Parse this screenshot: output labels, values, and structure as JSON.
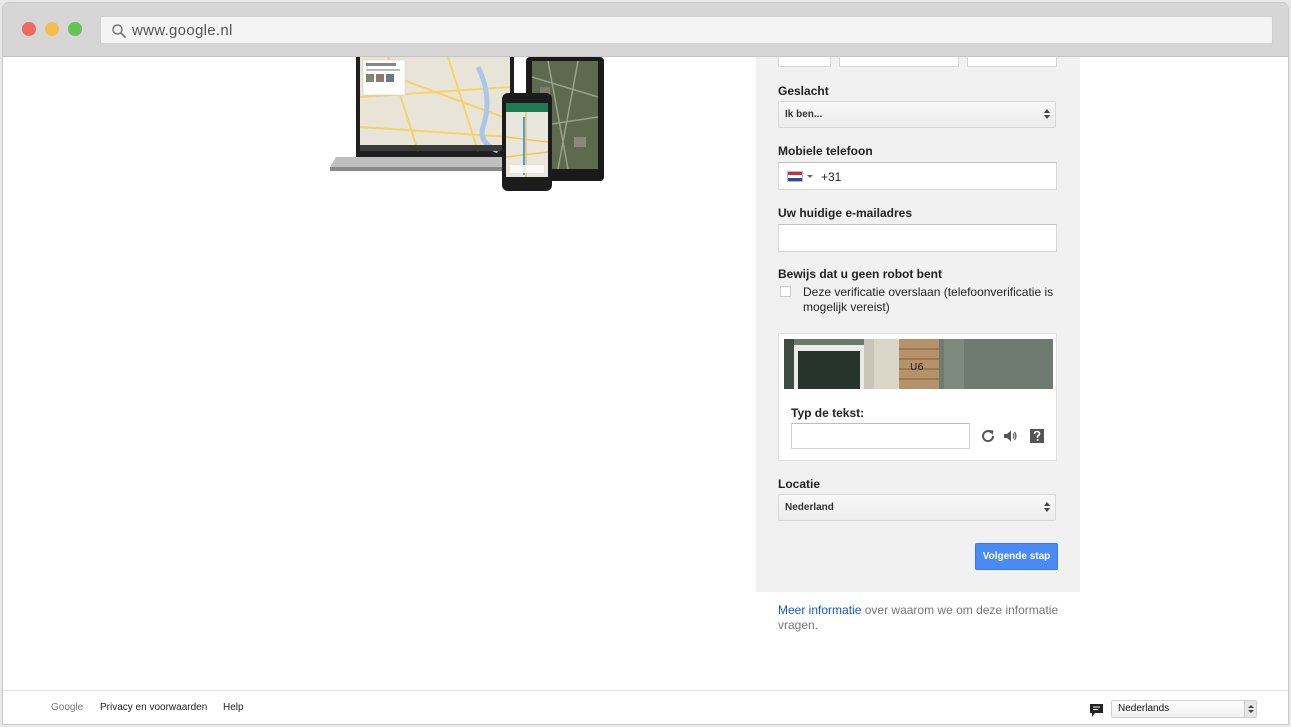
{
  "browser": {
    "url": "www.google.nl"
  },
  "form": {
    "gender": {
      "label": "Geslacht",
      "value": "Ik ben..."
    },
    "phone": {
      "label": "Mobiele telefoon",
      "prefix": "+31"
    },
    "email": {
      "label": "Uw huidige e-mailadres"
    },
    "robot": {
      "label": "Bewijs dat u geen robot bent",
      "skip_text": "Deze verificatie overslaan (telefoonverificatie is mogelijk vereist)"
    },
    "captcha": {
      "label": "Typ de tekst:",
      "image_text": "U6"
    },
    "location": {
      "label": "Locatie",
      "value": "Nederland"
    },
    "next_button": "Volgende stap"
  },
  "info": {
    "link": "Meer informatie",
    "rest": "over waarom we om deze informatie vragen."
  },
  "footer": {
    "google": "Google",
    "privacy": "Privacy en voorwaarden",
    "help": "Help",
    "language": "Nederlands"
  },
  "colors": {
    "primary_button": "#4a8af4",
    "link": "#1155cc",
    "panel_bg": "#f1f1f1"
  }
}
